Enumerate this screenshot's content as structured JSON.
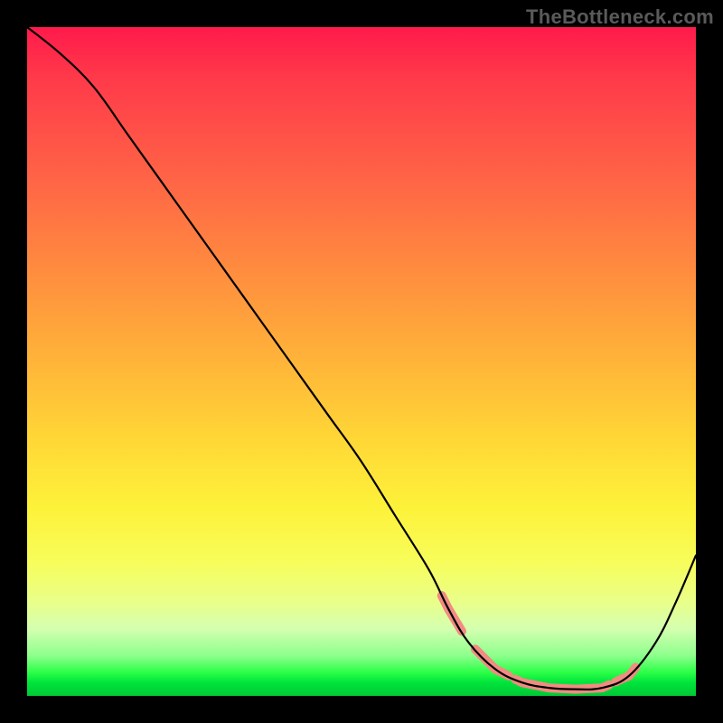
{
  "watermark": "TheBottleneck.com",
  "chart_data": {
    "type": "line",
    "title": "",
    "xlabel": "",
    "ylabel": "",
    "xlim": [
      0,
      100
    ],
    "ylim": [
      0,
      100
    ],
    "grid": false,
    "legend": false,
    "background": "rainbow-gradient-vertical",
    "series": [
      {
        "name": "bottleneck-curve",
        "color": "#000000",
        "x": [
          0,
          5,
          10,
          15,
          20,
          25,
          30,
          35,
          40,
          45,
          50,
          55,
          60,
          63,
          66,
          70,
          74,
          78,
          82,
          86,
          90,
          94,
          97,
          100
        ],
        "values": [
          100,
          96,
          91,
          84,
          77,
          70,
          63,
          56,
          49,
          42,
          35,
          27,
          19,
          13,
          8,
          4,
          2,
          1.2,
          1.0,
          1.2,
          3,
          8,
          14,
          21
        ]
      }
    ],
    "annotations": {
      "coral_highlight_segments": [
        {
          "x0": 62,
          "x1": 65
        },
        {
          "x0": 67,
          "x1": 72
        },
        {
          "x0": 73,
          "x1": 87
        },
        {
          "x0": 88,
          "x1": 91
        }
      ],
      "note": "coral-colored short dashes overlaid on the curve near its minimum"
    }
  }
}
